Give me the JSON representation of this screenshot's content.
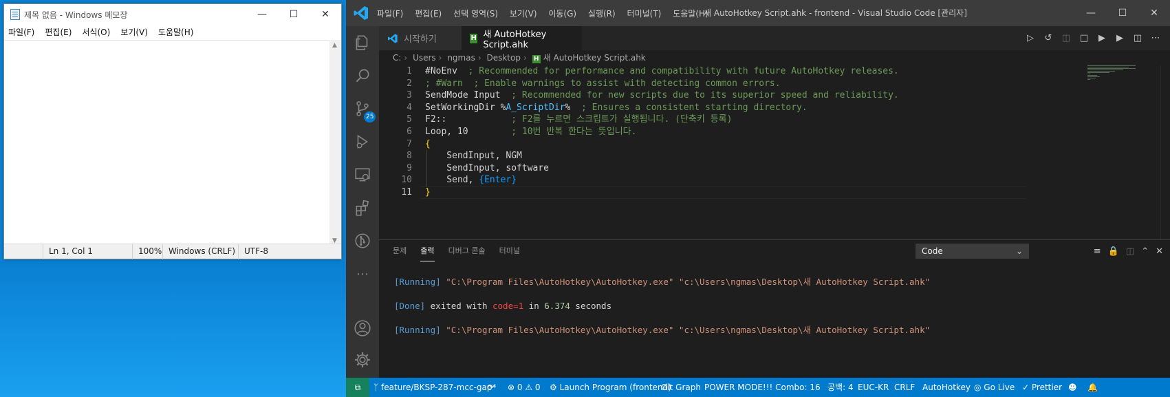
{
  "notepad": {
    "title": "제목 없음 - Windows 메모장",
    "menu": [
      "파일(F)",
      "편집(E)",
      "서식(O)",
      "보기(V)",
      "도움말(H)"
    ],
    "status": {
      "position": "Ln 1, Col 1",
      "zoom": "100%",
      "line_ending": "Windows (CRLF)",
      "encoding": "UTF-8"
    }
  },
  "vscode": {
    "menu": [
      "파일(F)",
      "편집(E)",
      "선택 영역(S)",
      "보기(V)",
      "이동(G)",
      "실행(R)",
      "터미널(T)",
      "도움말(H)"
    ],
    "window_title": "새 AutoHotkey Script.ahk - frontend - Visual Studio Code [관리자]",
    "tabs": [
      {
        "label": "시작하기",
        "icon": "vscode-icon"
      },
      {
        "label": "새 AutoHotkey Script.ahk",
        "icon": "ahk-file-icon"
      }
    ],
    "breadcrumbs": [
      "C:",
      "Users",
      "ngmas",
      "Desktop",
      "새 AutoHotkey Script.ahk"
    ],
    "scm_badge": "25",
    "code_lines": [
      {
        "n": "1",
        "parts": [
          [
            "kw",
            "#NoEnv  "
          ],
          [
            "cm",
            "; Recommended for performance and compatibility with future AutoHotkey releases."
          ]
        ]
      },
      {
        "n": "2",
        "parts": [
          [
            "cm",
            "; #Warn  ; Enable warnings to assist with detecting common errors."
          ]
        ]
      },
      {
        "n": "3",
        "parts": [
          [
            "kw",
            "SendMode Input  "
          ],
          [
            "cm",
            "; Recommended for new scripts due to its superior speed and reliability."
          ]
        ]
      },
      {
        "n": "4",
        "parts": [
          [
            "kw",
            "SetWorkingDir "
          ],
          [
            "kw",
            "%"
          ],
          [
            "v",
            "A_ScriptDir"
          ],
          [
            "kw",
            "%  "
          ],
          [
            "cm",
            "; Ensures a consistent starting directory."
          ]
        ]
      },
      {
        "n": "5",
        "parts": [
          [
            "kw",
            "F2::            "
          ],
          [
            "cm",
            "; F2를 누르면 스크립트가 실행됩니다. (단축키 등록)"
          ]
        ]
      },
      {
        "n": "6",
        "parts": [
          [
            "kw",
            "Loop, 10        "
          ],
          [
            "cm",
            "; 10번 반복 한다는 뜻입니다."
          ]
        ]
      },
      {
        "n": "7",
        "parts": [
          [
            "br",
            "{"
          ]
        ]
      },
      {
        "n": "8",
        "parts": [
          [
            "kw",
            "    SendInput, NGM"
          ]
        ]
      },
      {
        "n": "9",
        "parts": [
          [
            "kw",
            "    SendInput, software"
          ]
        ]
      },
      {
        "n": "10",
        "parts": [
          [
            "kw",
            "    Send, "
          ],
          [
            "bl",
            "{Enter}"
          ]
        ]
      },
      {
        "n": "11",
        "parts": [
          [
            "br",
            "}"
          ]
        ]
      }
    ],
    "panel": {
      "tabs": [
        "문제",
        "출력",
        "디버그 콘솔",
        "터미널"
      ],
      "active_tab": "출력",
      "select_value": "Code",
      "output": [
        {
          "type": "run",
          "tag": "[Running]",
          "text": " \"C:\\Program Files\\AutoHotkey\\AutoHotkey.exe\" \"c:\\Users\\ngmas\\Desktop\\새 AutoHotkey Script.ahk\""
        },
        {
          "type": "done",
          "tag": "[Done]",
          "pre": " exited with ",
          "code": "code=1",
          "mid": " in ",
          "num": "6.374",
          "post": " seconds"
        },
        {
          "type": "run",
          "tag": "[Running]",
          "text": " \"C:\\Program Files\\AutoHotkey\\AutoHotkey.exe\" \"c:\\Users\\ngmas\\Desktop\\새 AutoHotkey Script.ahk\""
        }
      ]
    },
    "status": {
      "branch": "feature/BKSP-287-mcc-gap*",
      "problems": "⊗ 0 ⚠ 0",
      "launch": "Launch Program (frontend)",
      "git_graph": "Git Graph",
      "power_mode": "POWER MODE!!! Combo: 16",
      "spaces": "공백: 4",
      "encoding": "EUC-KR",
      "eol": "CRLF",
      "language": "AutoHotkey",
      "go_live": "Go Live",
      "prettier": "✓ Prettier"
    }
  }
}
